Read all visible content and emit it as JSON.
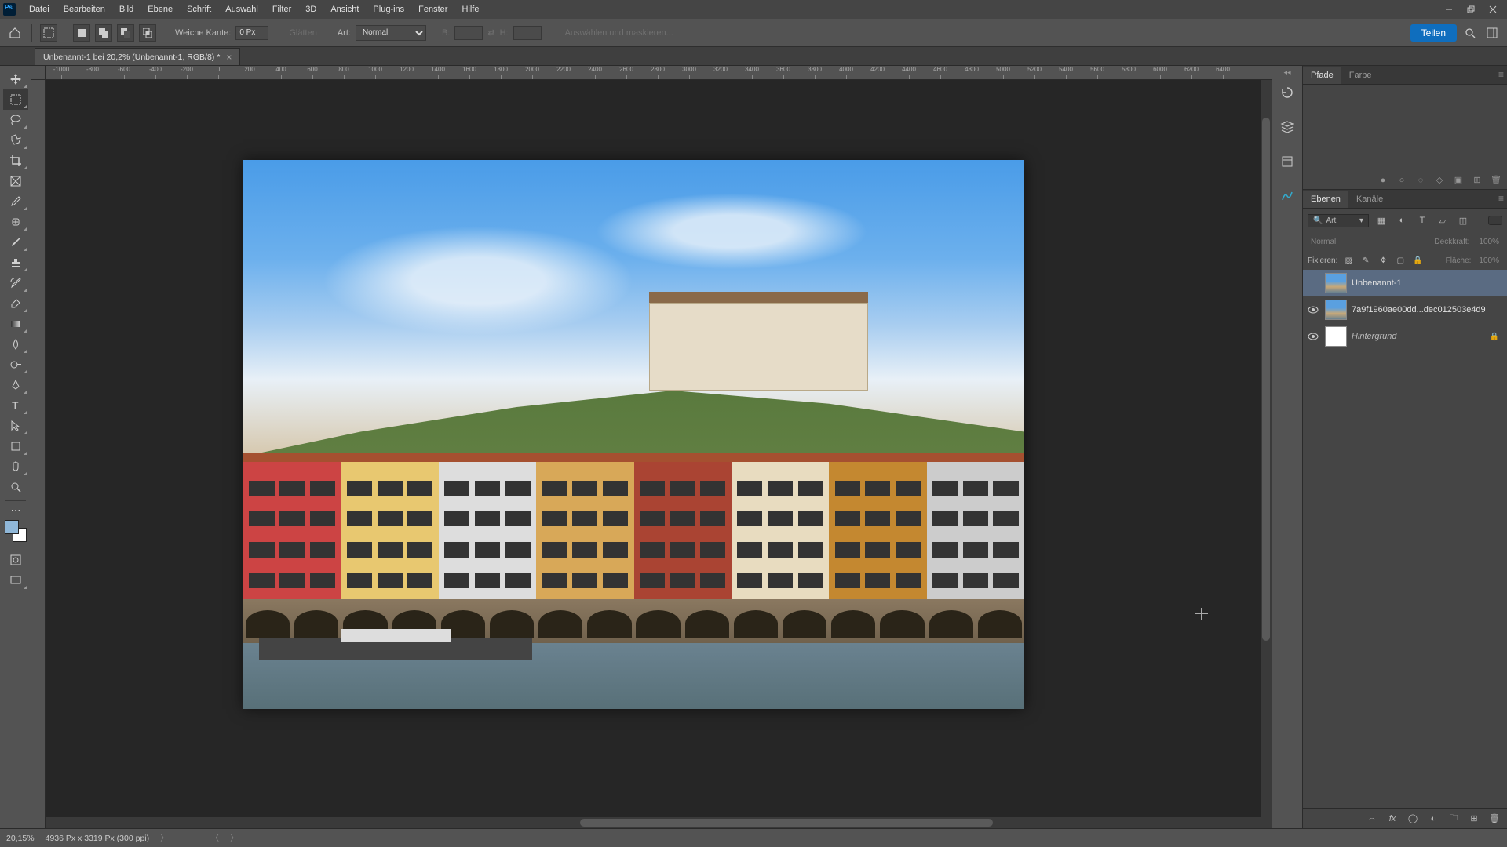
{
  "menu": [
    "Datei",
    "Bearbeiten",
    "Bild",
    "Ebene",
    "Schrift",
    "Auswahl",
    "Filter",
    "3D",
    "Ansicht",
    "Plug-ins",
    "Fenster",
    "Hilfe"
  ],
  "options": {
    "feather_label": "Weiche Kante:",
    "feather_value": "0 Px",
    "smooth_label": "Glätten",
    "style_label": "Art:",
    "style_value": "Normal",
    "width_label": "B:",
    "height_label": "H:",
    "refine_label": "Auswählen und maskieren...",
    "share_label": "Teilen"
  },
  "doc_tab": "Unbenannt-1 bei 20,2% (Unbenannt-1, RGB/8) *",
  "ruler_marks": [
    "-1000",
    "-800",
    "-600",
    "-400",
    "-200",
    "0",
    "200",
    "400",
    "600",
    "800",
    "1000",
    "1200",
    "1400",
    "1600",
    "1800",
    "2000",
    "2200",
    "2400",
    "2600",
    "2800",
    "3000",
    "3200",
    "3400",
    "3600",
    "3800",
    "4000",
    "4200",
    "4400",
    "4600",
    "4800",
    "5000",
    "5200",
    "5400",
    "5600",
    "5800",
    "6000",
    "6200",
    "6400"
  ],
  "tools": [
    "move",
    "marquee",
    "lasso",
    "wand",
    "crop",
    "frame",
    "eyedrop",
    "heal",
    "brush",
    "stamp",
    "history",
    "eraser",
    "gradient",
    "blur",
    "dodge",
    "pen",
    "type",
    "path",
    "rect",
    "hand",
    "zoom"
  ],
  "panels": {
    "top_tabs": {
      "a": "Pfade",
      "b": "Farbe"
    },
    "layers_tabs": {
      "a": "Ebenen",
      "b": "Kanäle"
    },
    "filter_type": "Art",
    "blend_mode": "Normal",
    "opacity_label": "Deckkraft:",
    "opacity_value": "100%",
    "lock_label": "Fixieren:",
    "fill_label": "Fläche:",
    "fill_value": "100%",
    "layers": [
      {
        "name": "Unbenannt-1",
        "visible": false,
        "selected": true
      },
      {
        "name": "7a9f1960ae00dd...dec012503e4d9",
        "visible": true,
        "selected": false
      },
      {
        "name": "Hintergrund",
        "visible": true,
        "selected": false,
        "locked": true,
        "italic": true
      }
    ]
  },
  "status": {
    "zoom": "20,15%",
    "doc_info": "4936 Px x 3319 Px (300 ppi)"
  }
}
